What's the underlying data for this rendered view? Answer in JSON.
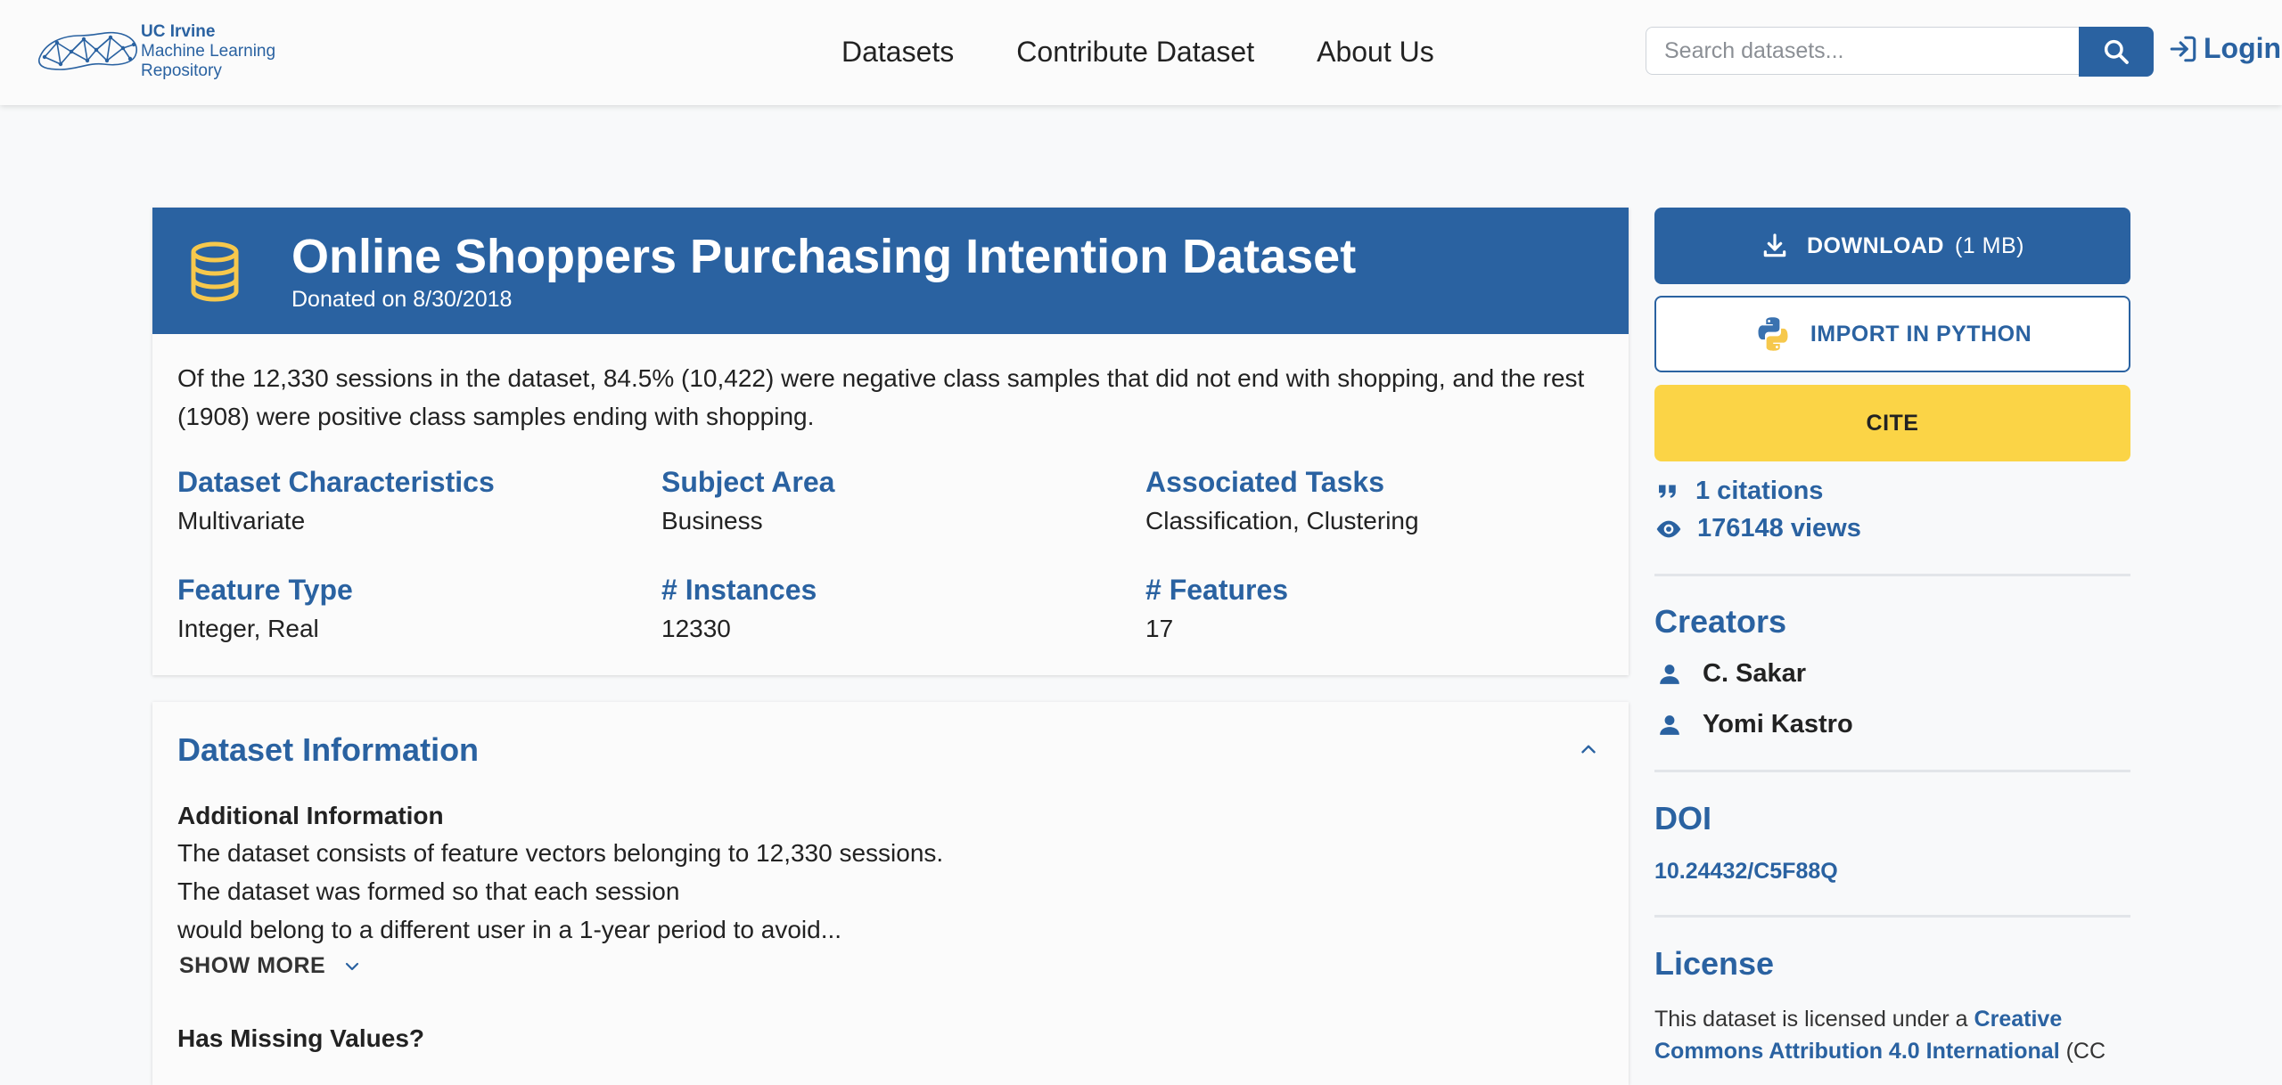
{
  "header": {
    "logo_line1": "UC Irvine",
    "logo_line2": "Machine Learning",
    "logo_line3": "Repository",
    "nav": [
      "Datasets",
      "Contribute Dataset",
      "About Us"
    ],
    "search_placeholder": "Search datasets...",
    "login_label": "Login"
  },
  "dataset": {
    "title": "Online Shoppers Purchasing Intention Dataset",
    "donated": "Donated on 8/30/2018",
    "summary": "Of the 12,330 sessions in the dataset, 84.5% (10,422) were negative class samples that did not end with shopping, and the rest (1908) were positive class samples ending with shopping.",
    "characteristics": [
      {
        "label": "Dataset Characteristics",
        "value": "Multivariate"
      },
      {
        "label": "Subject Area",
        "value": "Business"
      },
      {
        "label": "Associated Tasks",
        "value": "Classification, Clustering"
      },
      {
        "label": "Feature Type",
        "value": "Integer, Real"
      },
      {
        "label": "# Instances",
        "value": "12330"
      },
      {
        "label": "# Features",
        "value": "17"
      }
    ]
  },
  "info": {
    "title": "Dataset Information",
    "additional_heading": "Additional Information",
    "lines": [
      "The dataset consists of feature vectors belonging to 12,330 sessions.",
      "The dataset was formed so that each session",
      "would belong to a different user in a 1-year period to avoid..."
    ],
    "show_more": "SHOW MORE",
    "missing_heading": "Has Missing Values?"
  },
  "sidebar": {
    "download_label": "DOWNLOAD",
    "download_size": "(1 MB)",
    "python_label": "IMPORT IN PYTHON",
    "cite_label": "CITE",
    "citations": "1 citations",
    "views": "176148 views",
    "creators_heading": "Creators",
    "creators": [
      "C. Sakar",
      "Yomi Kastro"
    ],
    "doi_heading": "DOI",
    "doi": "10.24432/C5F88Q",
    "license_heading": "License",
    "license_prefix": "This dataset is licensed under a ",
    "license_link": "Creative Commons Attribution 4.0 International",
    "license_suffix": " (CC"
  },
  "colors": {
    "brand_blue": "#2a62a1",
    "cite_yellow": "#fbd446",
    "db_icon_yellow": "#f6c84c"
  }
}
